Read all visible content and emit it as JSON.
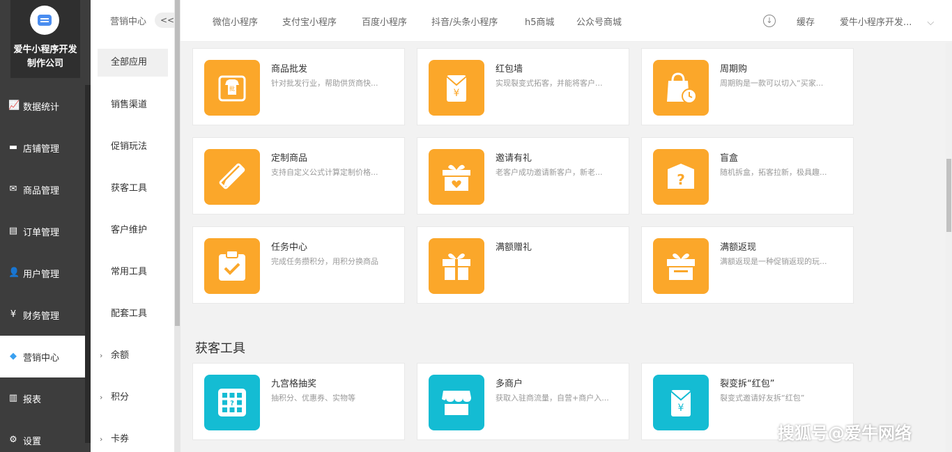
{
  "brand": {
    "name": "爱牛小程序开发制作公司"
  },
  "nav": [
    {
      "label": "数据统计",
      "icon": "chart-line-icon",
      "glyph": "📈"
    },
    {
      "label": "店铺管理",
      "icon": "store-icon",
      "glyph": "▬"
    },
    {
      "label": "商品管理",
      "icon": "goods-icon",
      "glyph": "✉"
    },
    {
      "label": "订单管理",
      "icon": "order-icon",
      "glyph": "▤"
    },
    {
      "label": "用户管理",
      "icon": "user-icon",
      "glyph": "👤"
    },
    {
      "label": "财务管理",
      "icon": "finance-icon",
      "glyph": "¥"
    },
    {
      "label": "营销中心",
      "icon": "marketing-icon",
      "glyph": "◆"
    },
    {
      "label": "报表",
      "icon": "report-icon",
      "glyph": "▥"
    },
    {
      "label": "设置",
      "icon": "settings-icon",
      "glyph": "⚙"
    }
  ],
  "sub": {
    "header": "营销中心",
    "collapse": "<<",
    "items": [
      {
        "label": "全部应用"
      },
      {
        "label": "销售渠道"
      },
      {
        "label": "促销玩法"
      },
      {
        "label": "获客工具"
      },
      {
        "label": "客户维护"
      },
      {
        "label": "常用工具"
      },
      {
        "label": "配套工具"
      },
      {
        "label": "余额"
      },
      {
        "label": "积分"
      },
      {
        "label": "卡券"
      }
    ]
  },
  "top": {
    "tabs": [
      "微信小程序",
      "支付宝小程序",
      "百度小程序",
      "抖音/头条小程序",
      "h5商城",
      "公众号商城"
    ],
    "cache": "缓存",
    "account": "爱牛小程序开发..."
  },
  "cards": [
    {
      "title": "商品批发",
      "desc": "针对批发行业，帮助供货商快...",
      "icon": "wholesale-icon"
    },
    {
      "title": "红包墙",
      "desc": "实现裂变式拓客，并能将客户...",
      "icon": "red-envelope-icon"
    },
    {
      "title": "周期购",
      "desc": "周期购是一款可以切入“买家...",
      "icon": "periodic-shopping-icon"
    },
    {
      "title": "定制商品",
      "desc": "支持自定义公式计算定制价格...",
      "icon": "ruler-pencil-icon"
    },
    {
      "title": "邀请有礼",
      "desc": "老客户成功邀请新客户，新老...",
      "icon": "gift-heart-icon"
    },
    {
      "title": "盲盒",
      "desc": "随机拆盒，拓客拉新，极具趣...",
      "icon": "blind-box-icon"
    },
    {
      "title": "任务中心",
      "desc": "完成任务攒积分，用积分换商品",
      "icon": "task-clipboard-icon"
    },
    {
      "title": "满额赠礼",
      "desc": "",
      "icon": "gift-icon"
    },
    {
      "title": "满额返现",
      "desc": "满额返现是一种促销返现的玩...",
      "icon": "cashback-box-icon"
    }
  ],
  "section": {
    "title": "获客工具"
  },
  "cards2": [
    {
      "title": "九宫格抽奖",
      "desc": "抽积分、优惠券、实物等",
      "icon": "grid-lottery-icon"
    },
    {
      "title": "多商户",
      "desc": "获取入驻商流量，自营+商户入...",
      "icon": "shop-icon"
    },
    {
      "title": "裂变拆“红包”",
      "desc": "裂变式邀请好友拆“红包”",
      "icon": "red-envelope-icon"
    }
  ],
  "watermark": "搜狐号@爱牛网络",
  "colors": {
    "orange": "#fba72a",
    "cyan": "#14bcd3",
    "sidebar": "#3d3d3d"
  }
}
